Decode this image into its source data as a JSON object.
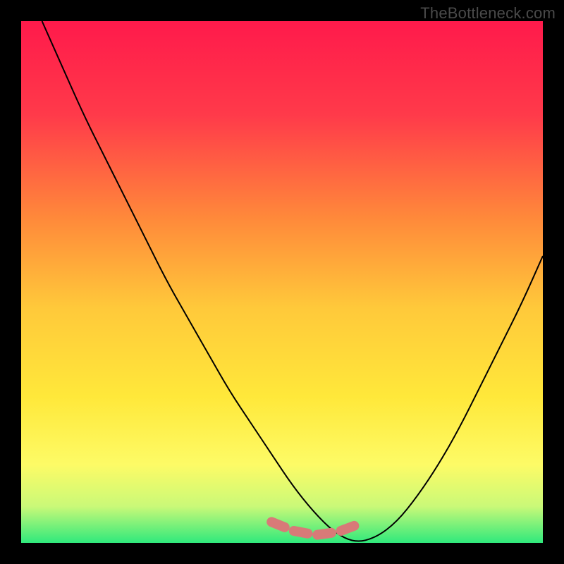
{
  "watermark": "TheBottleneck.com",
  "chart_data": {
    "type": "line",
    "title": "",
    "xlabel": "",
    "ylabel": "",
    "xlim": [
      0,
      100
    ],
    "ylim": [
      0,
      100
    ],
    "background_gradient_stops": [
      {
        "offset": 0.0,
        "color": "#ff1a4b"
      },
      {
        "offset": 0.18,
        "color": "#ff3a4a"
      },
      {
        "offset": 0.38,
        "color": "#ff8a3a"
      },
      {
        "offset": 0.55,
        "color": "#ffc93a"
      },
      {
        "offset": 0.72,
        "color": "#ffe83a"
      },
      {
        "offset": 0.85,
        "color": "#fdfb66"
      },
      {
        "offset": 0.93,
        "color": "#caf978"
      },
      {
        "offset": 1.0,
        "color": "#2fe97c"
      }
    ],
    "curve": {
      "x": [
        4,
        8,
        12,
        16,
        20,
        24,
        28,
        32,
        36,
        40,
        44,
        48,
        52,
        56,
        60,
        64,
        68,
        72,
        76,
        80,
        84,
        88,
        92,
        96,
        100
      ],
      "y": [
        100,
        91,
        82,
        74,
        66,
        58,
        50,
        43,
        36,
        29,
        23,
        17,
        11,
        6,
        2,
        0,
        1,
        4,
        9,
        15,
        22,
        30,
        38,
        46,
        55
      ]
    },
    "marker_band": {
      "color": "#d87a78",
      "x_range": [
        48,
        65
      ],
      "y_level": 1.5
    }
  }
}
